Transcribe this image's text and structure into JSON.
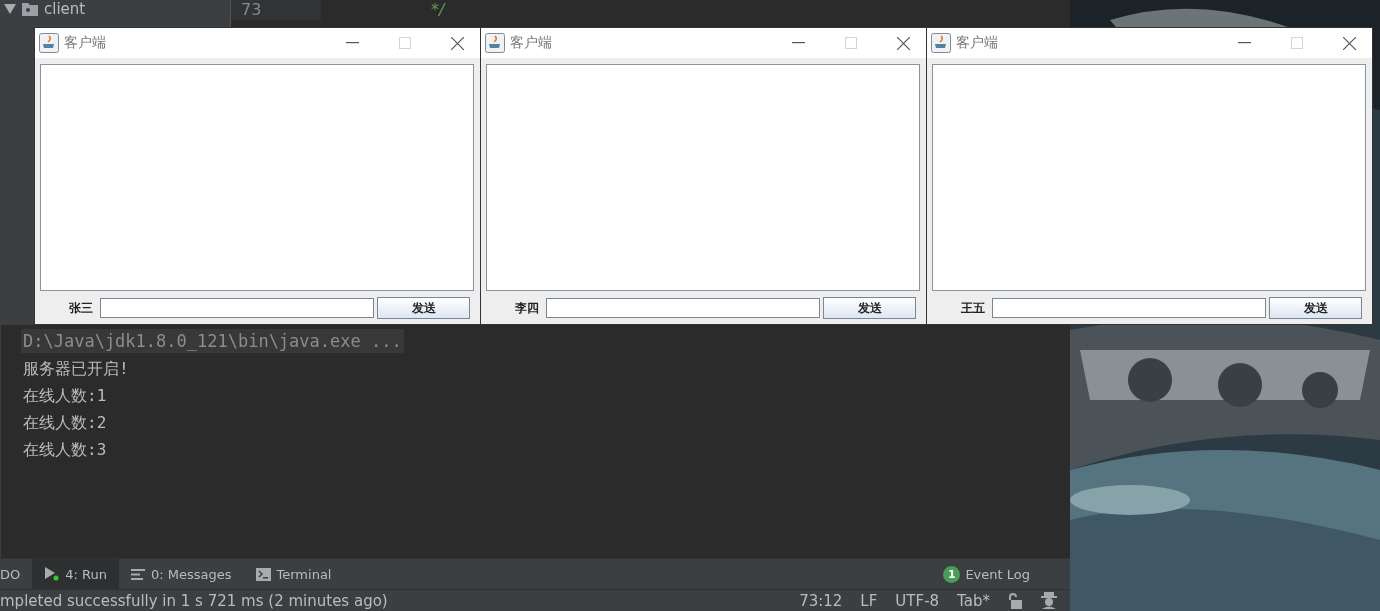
{
  "ide": {
    "project_tree": [
      {
        "label": "client"
      }
    ],
    "editor": {
      "line_number": "73",
      "code": "*/"
    },
    "console": {
      "command": "D:\\Java\\jdk1.8.0_121\\bin\\java.exe ...",
      "lines": [
        "服务器已开启!",
        "在线人数:1",
        "在线人数:2",
        "在线人数:3"
      ]
    },
    "tool_tabs": [
      {
        "label": "DO",
        "kind": "plain",
        "selected": false
      },
      {
        "label": "4: Run",
        "kind": "run",
        "selected": true
      },
      {
        "label": "0: Messages",
        "kind": "messages",
        "selected": false
      },
      {
        "label": "Terminal",
        "kind": "terminal",
        "selected": false
      }
    ],
    "event_log": {
      "count": "1",
      "label": "Event Log"
    },
    "status_bar": {
      "message": "mpleted successfully in 1 s 721 ms (2 minutes ago)",
      "position": "73:12",
      "line_separator": "LF",
      "encoding": "UTF-8",
      "indent": "Tab*"
    }
  },
  "client_windows": [
    {
      "title": "客户端",
      "user": "张三",
      "send_button": "发送"
    },
    {
      "title": "客户端",
      "user": "李四",
      "send_button": "发送"
    },
    {
      "title": "客户端",
      "user": "王五",
      "send_button": "发送"
    }
  ]
}
